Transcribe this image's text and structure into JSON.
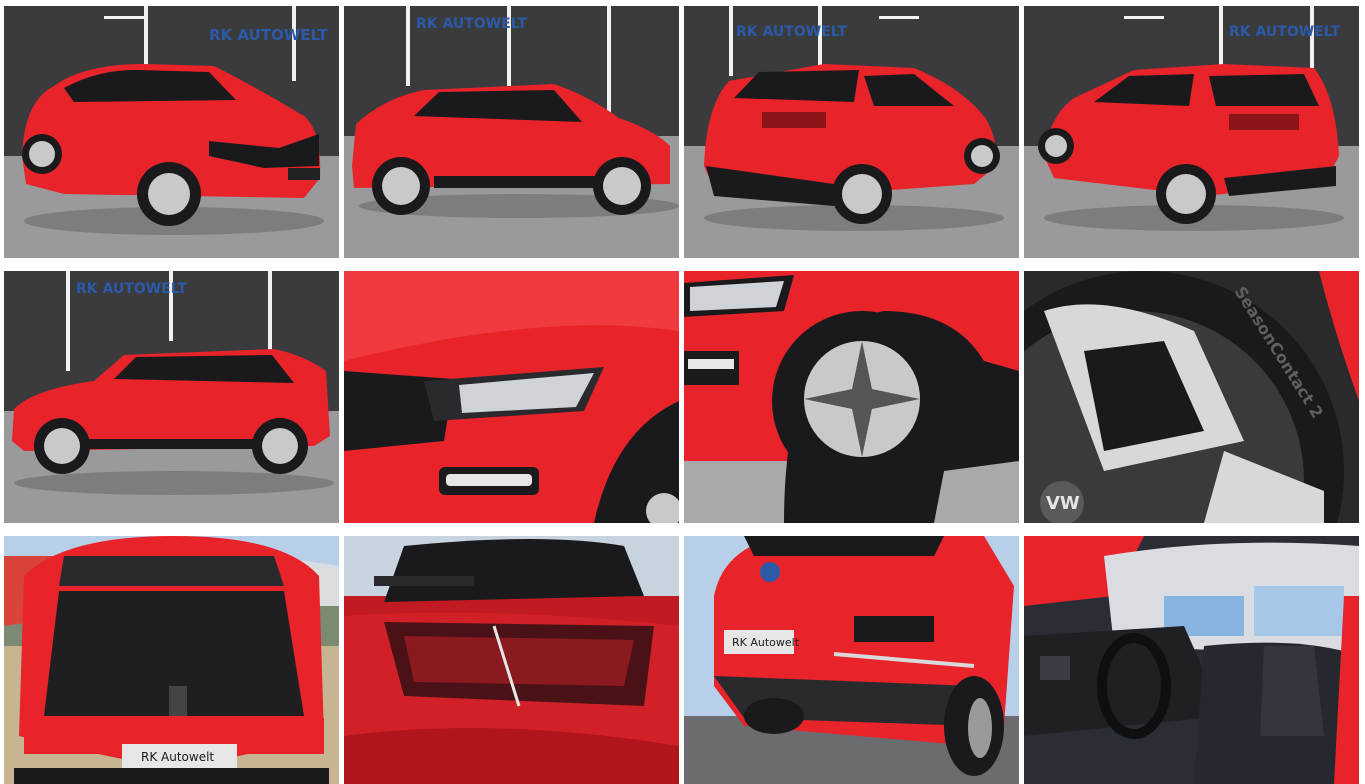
{
  "gallery": {
    "studio_logo_text": "RK AUTOWELT",
    "plate_text": "RK Autowelt",
    "tire_text": "SeasonContact 2",
    "colors": {
      "body_red": "#e8232a",
      "studio_wall": "#3b3b3d",
      "studio_floor": "#9a9a9c",
      "sky": "#b8cfe8",
      "black_trim": "#1a1a1c",
      "logo_blue": "#2a5aa8"
    },
    "photos": [
      {
        "view": "front-left-three-quarter"
      },
      {
        "view": "right-side-profile"
      },
      {
        "view": "rear-right-three-quarter"
      },
      {
        "view": "rear-left-three-quarter"
      },
      {
        "view": "left-side-profile"
      },
      {
        "view": "headlight-closeup"
      },
      {
        "view": "front-wheel-closeup"
      },
      {
        "view": "alloy-rim-closeup"
      },
      {
        "view": "open-trunk"
      },
      {
        "view": "taillight-closeup"
      },
      {
        "view": "rear-bumper-low-angle"
      },
      {
        "view": "interior-driver-side"
      }
    ]
  }
}
